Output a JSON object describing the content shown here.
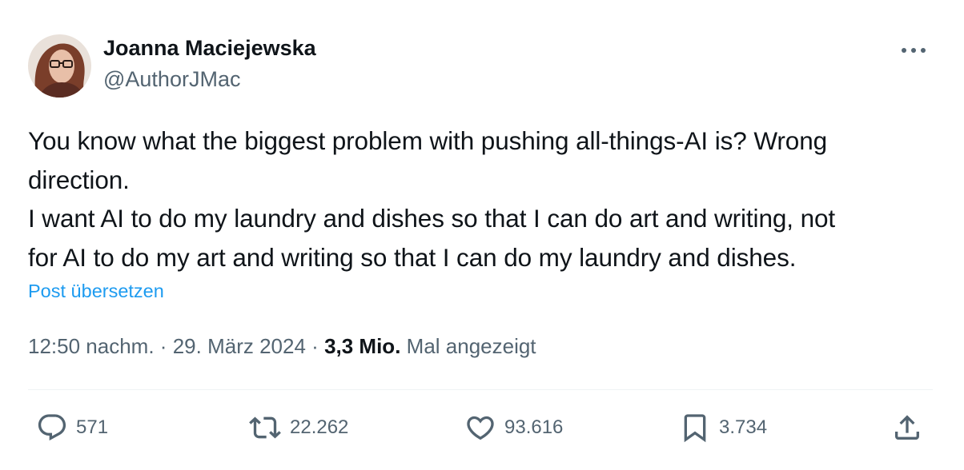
{
  "author": {
    "name": "Joanna Maciejewska",
    "handle": "@AuthorJMac"
  },
  "more_icon": "more-horizontal-icon",
  "tweet_text": [
    "You know what the biggest problem with pushing all-things-AI is? Wrong",
    "direction.",
    "I want AI to do my laundry and dishes so that I can do art and writing, not",
    "for AI to do my art and writing so that I can do my laundry and dishes."
  ],
  "translate_label": "Post übersetzen",
  "meta": {
    "time": "12:50 nachm.",
    "separator": "·",
    "date": "29. März 2024",
    "views_count": "3,3 Mio.",
    "views_label": "Mal angezeigt"
  },
  "actions": {
    "replies": {
      "icon": "reply-icon",
      "count": "571"
    },
    "reposts": {
      "icon": "repost-icon",
      "count": "22.262"
    },
    "likes": {
      "icon": "heart-icon",
      "count": "93.616"
    },
    "bookmarks": {
      "icon": "bookmark-icon",
      "count": "3.734"
    },
    "share": {
      "icon": "share-icon"
    }
  },
  "colors": {
    "text": "#0f1419",
    "secondary": "#536471",
    "link": "#1d9bf0",
    "divider": "#eff3f4"
  }
}
